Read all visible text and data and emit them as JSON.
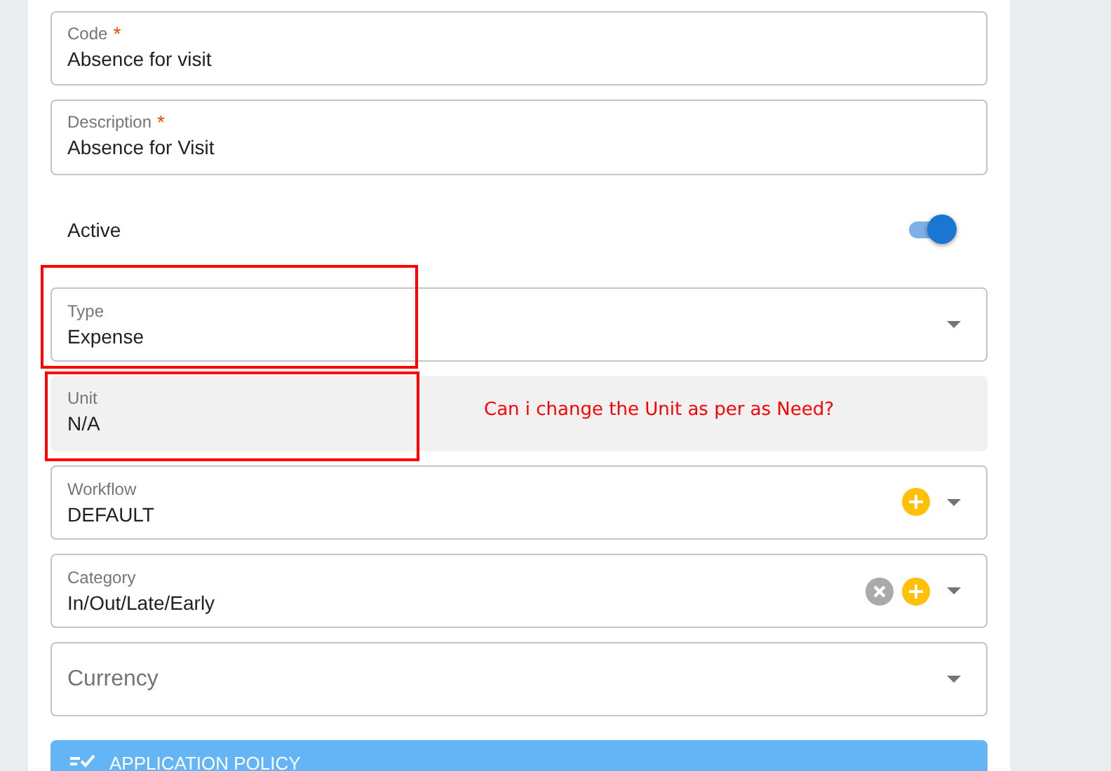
{
  "fields_top": [
    {
      "label": "Code",
      "required_mark": "*",
      "value": "Absence for visit"
    },
    {
      "label": "Description",
      "required_mark": "*",
      "value": "Absence for Visit"
    }
  ],
  "active": {
    "label": "Active",
    "on": true
  },
  "fields": [
    {
      "kind": "select",
      "label": "Type",
      "value": "Expense",
      "clear": false,
      "add": false
    },
    {
      "kind": "readonly",
      "label": "Unit",
      "value": "N/A"
    },
    {
      "kind": "select",
      "label": "Workflow",
      "value": "DEFAULT",
      "clear": false,
      "add": true
    },
    {
      "kind": "select",
      "label": "Category",
      "value": "In/Out/Late/Early",
      "clear": true,
      "add": true
    },
    {
      "kind": "select",
      "placeholder": "Currency",
      "clear": false,
      "add": false
    }
  ],
  "section": {
    "title": "APPLICATION POLICY"
  },
  "annotation": {
    "text": "Can i change the Unit as per as Need?"
  }
}
